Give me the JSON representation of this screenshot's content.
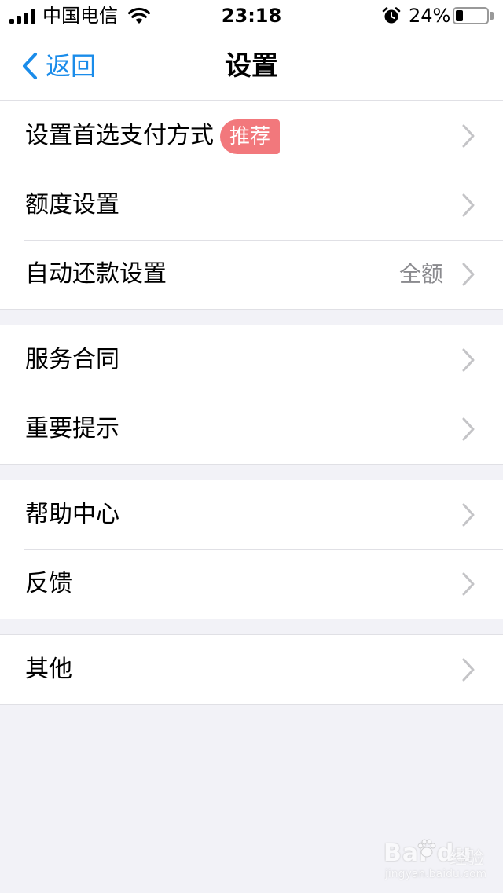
{
  "status_bar": {
    "carrier": "中国电信",
    "time": "23:18",
    "battery_percent_label": "24%",
    "battery_level": 0.24
  },
  "nav": {
    "back_label": "返回",
    "title": "设置"
  },
  "groups": [
    {
      "items": [
        {
          "label": "设置首选支付方式",
          "badge": "推荐"
        },
        {
          "label": "额度设置"
        },
        {
          "label": "自动还款设置",
          "value": "全额"
        }
      ]
    },
    {
      "items": [
        {
          "label": "服务合同"
        },
        {
          "label": "重要提示"
        }
      ]
    },
    {
      "items": [
        {
          "label": "帮助中心"
        },
        {
          "label": "反馈"
        }
      ]
    },
    {
      "items": [
        {
          "label": "其他"
        }
      ]
    }
  ],
  "watermark": {
    "logo": "Bai du",
    "brand": "经验",
    "url": "jingyan.baidu.com"
  },
  "colors": {
    "accent": "#1a8cea",
    "badge": "#f2787c",
    "background": "#f2f2f7",
    "separator": "#e0e0e5",
    "secondary_text": "#8a8a8e",
    "chevron": "#c4c4c7"
  },
  "icons": [
    "signal-icon",
    "wifi-icon",
    "alarm-icon",
    "battery-icon",
    "back-chevron-icon",
    "chevron-right-icon"
  ]
}
